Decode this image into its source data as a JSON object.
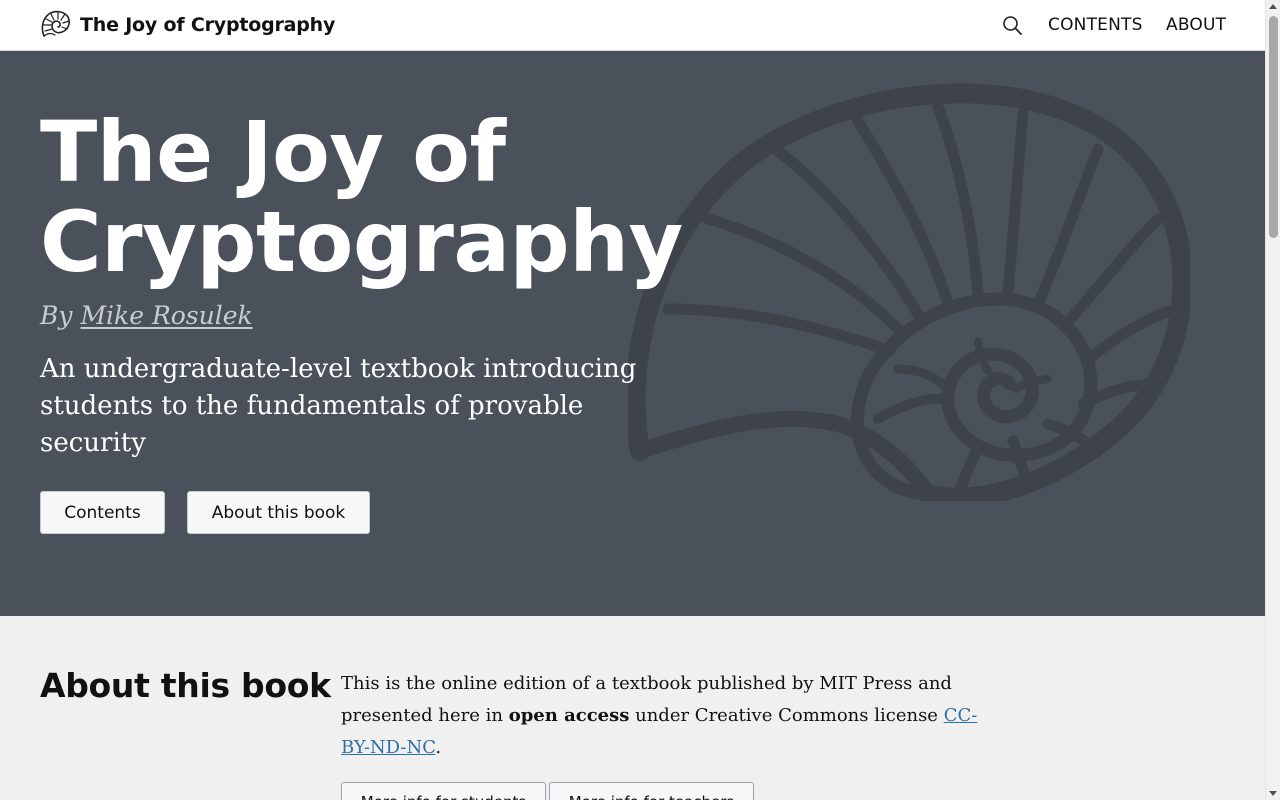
{
  "navbar": {
    "brand_title": "The Joy of Cryptography",
    "brand_icon": "nautilus-shell-icon",
    "search_icon": "search-icon",
    "links": {
      "contents": "CONTENTS",
      "about": "ABOUT"
    }
  },
  "hero": {
    "title_line1": "The Joy of",
    "title_line2": "Cryptography",
    "by_prefix": "By ",
    "author": "Mike Rosulek",
    "subtitle": "An undergraduate-level textbook introducing students to the fundamentals of provable security",
    "buttons": {
      "contents": "Contents",
      "about": "About this book"
    },
    "decoration_icon": "nautilus-shell-icon"
  },
  "about": {
    "heading": "About this book",
    "text_part1": "This is the online edition of a textbook published by MIT Press and presented here in ",
    "text_bold": "open access",
    "text_part2": " under Creative Commons license ",
    "license_link": "CC-BY-ND-NC",
    "text_end": ".",
    "buttons": {
      "students": "More info for students",
      "teachers": "More info for teachers"
    }
  },
  "colors": {
    "hero_background": "#4b515b",
    "shell_tint": "#3e434b",
    "link": "#2f6fa3",
    "section_background": "#f0f0f0"
  }
}
